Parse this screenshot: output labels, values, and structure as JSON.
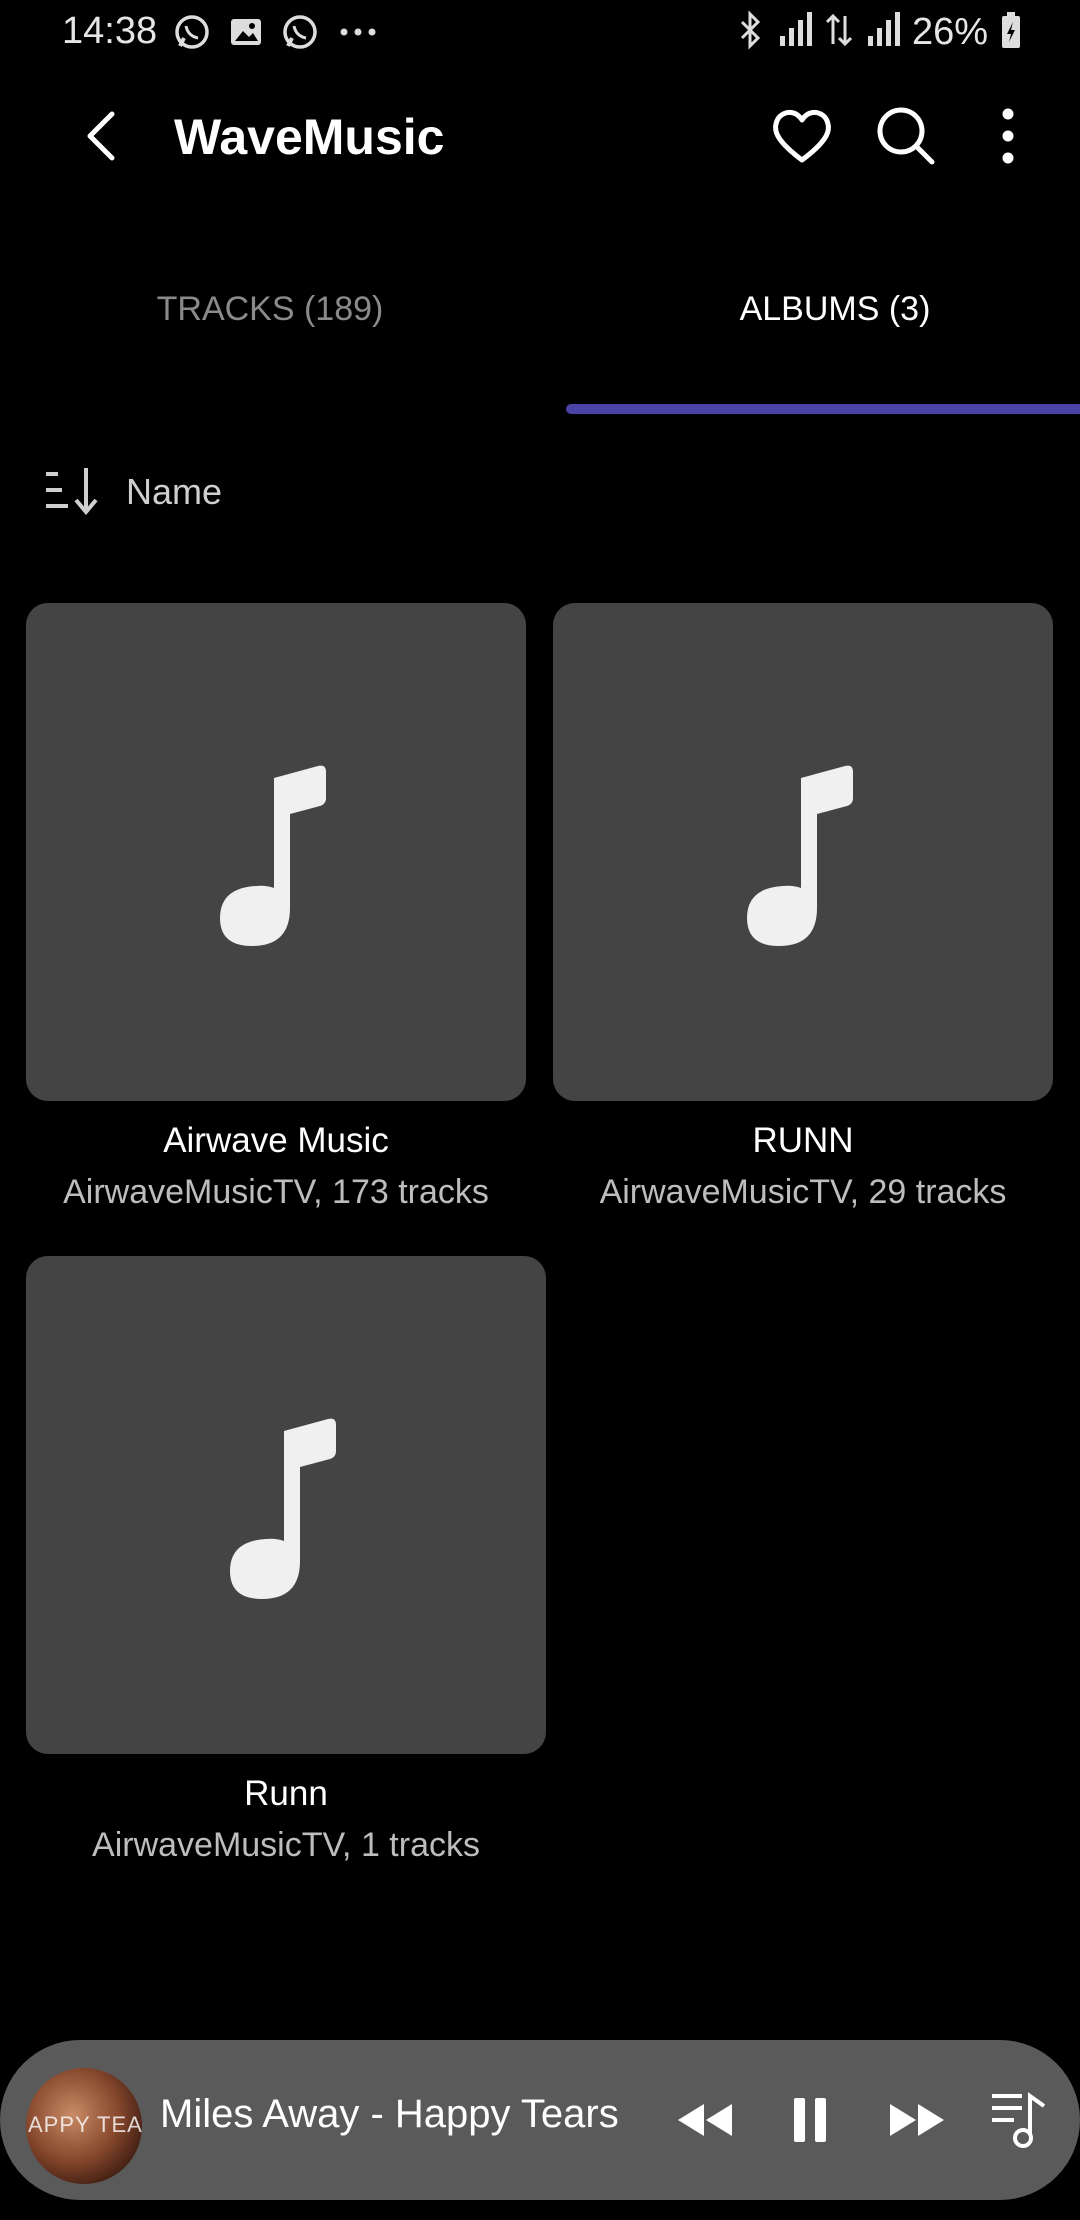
{
  "status_bar": {
    "time": "14:38",
    "battery_percent": "26%",
    "icons": [
      "whatsapp-icon",
      "image-icon",
      "whatsapp-icon",
      "more-notifications-icon",
      "bluetooth-icon",
      "signal-icon",
      "data-arrows-icon",
      "signal-icon",
      "battery-charging-icon"
    ]
  },
  "appbar": {
    "title": "WaveMusic",
    "icons": [
      "back-arrow-icon",
      "heart-icon",
      "search-icon",
      "more-vertical-icon"
    ]
  },
  "tabs": [
    {
      "label": "TRACKS (189)",
      "selected": false
    },
    {
      "label": "ALBUMS (3)",
      "selected": true
    }
  ],
  "sort": {
    "label": "Name",
    "icon": "sort-icon"
  },
  "albums": [
    {
      "title": "Airwave Music",
      "subtitle": "AirwaveMusicTV, 173 tracks",
      "icon": "music-note-icon"
    },
    {
      "title": "RUNN",
      "subtitle": "AirwaveMusicTV, 29 tracks",
      "icon": "music-note-icon"
    },
    {
      "title": "Runn",
      "subtitle": "AirwaveMusicTV, 1 tracks",
      "icon": "music-note-icon"
    }
  ],
  "mini_player": {
    "track": "Miles Away - Happy Tears",
    "thumbnail_text": "APPY TEAR",
    "icons": [
      "rewind-icon",
      "pause-icon",
      "fast-forward-icon",
      "queue-music-icon"
    ]
  },
  "colors": {
    "background": "#000000",
    "tab_indicator": "#4a43a6",
    "album_art": "#444444",
    "player_bg": "#5a5a5a"
  }
}
